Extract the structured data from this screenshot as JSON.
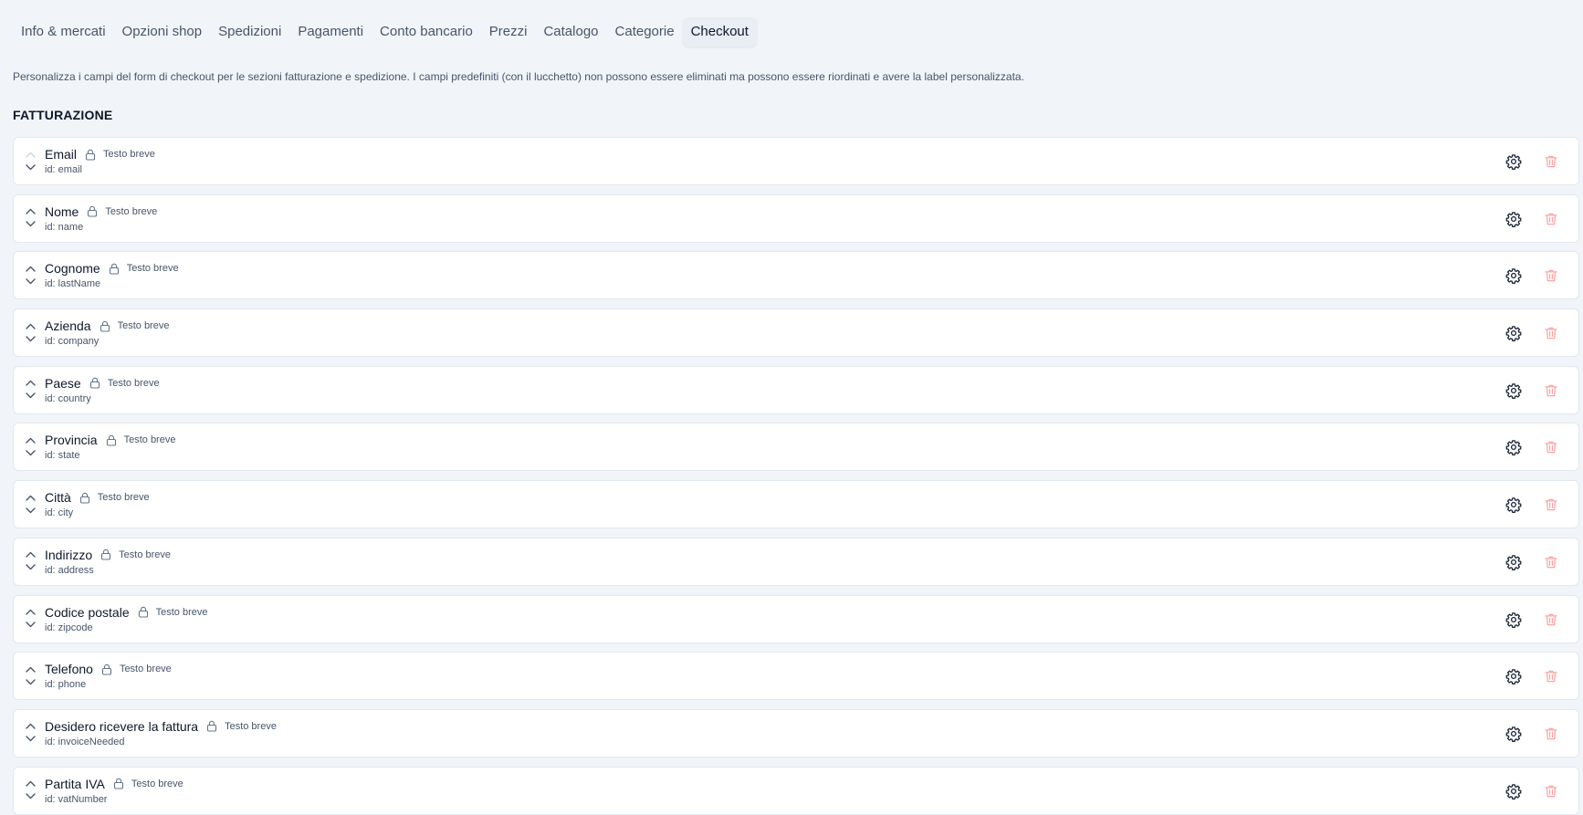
{
  "tabs": [
    {
      "label": "Info & mercati",
      "active": false
    },
    {
      "label": "Opzioni shop",
      "active": false
    },
    {
      "label": "Spedizioni",
      "active": false
    },
    {
      "label": "Pagamenti",
      "active": false
    },
    {
      "label": "Conto bancario",
      "active": false
    },
    {
      "label": "Prezzi",
      "active": false
    },
    {
      "label": "Catalogo",
      "active": false
    },
    {
      "label": "Categorie",
      "active": false
    },
    {
      "label": "Checkout",
      "active": true
    }
  ],
  "description": "Personalizza i campi del form di checkout per le sezioni fatturazione e spedizione. I campi predefiniti (con il lucchetto) non possono essere eliminati ma possono essere riordinati e avere la label personalizzata.",
  "billing": {
    "title": "FATTURAZIONE",
    "fields": [
      {
        "label": "Email",
        "type": "Testo breve",
        "id": "id: email",
        "locked": true,
        "can_move_up": false
      },
      {
        "label": "Nome",
        "type": "Testo breve",
        "id": "id: name",
        "locked": true,
        "can_move_up": true
      },
      {
        "label": "Cognome",
        "type": "Testo breve",
        "id": "id: lastName",
        "locked": true,
        "can_move_up": true
      },
      {
        "label": "Azienda",
        "type": "Testo breve",
        "id": "id: company",
        "locked": true,
        "can_move_up": true
      },
      {
        "label": "Paese",
        "type": "Testo breve",
        "id": "id: country",
        "locked": true,
        "can_move_up": true
      },
      {
        "label": "Provincia",
        "type": "Testo breve",
        "id": "id: state",
        "locked": true,
        "can_move_up": true
      },
      {
        "label": "Città",
        "type": "Testo breve",
        "id": "id: city",
        "locked": true,
        "can_move_up": true
      },
      {
        "label": "Indirizzo",
        "type": "Testo breve",
        "id": "id: address",
        "locked": true,
        "can_move_up": true
      },
      {
        "label": "Codice postale",
        "type": "Testo breve",
        "id": "id: zipcode",
        "locked": true,
        "can_move_up": true
      },
      {
        "label": "Telefono",
        "type": "Testo breve",
        "id": "id: phone",
        "locked": true,
        "can_move_up": true
      },
      {
        "label": "Desidero ricevere la fattura",
        "type": "Testo breve",
        "id": "id: invoiceNeeded",
        "locked": true,
        "can_move_up": true
      },
      {
        "label": "Partita IVA",
        "type": "Testo breve",
        "id": "id: vatNumber",
        "locked": true,
        "can_move_up": true
      }
    ]
  },
  "icons": {
    "reorder_up": "chevron-up-icon",
    "reorder_down": "chevron-down-icon",
    "locked": "lock-icon",
    "settings": "gear-icon",
    "delete": "trash-icon"
  },
  "colors": {
    "background": "#f1f5f9",
    "card": "#ffffff",
    "border": "#e2e8f0",
    "text": "#0f172a",
    "muted": "#475569",
    "delete_disabled": "#fca5a5"
  }
}
